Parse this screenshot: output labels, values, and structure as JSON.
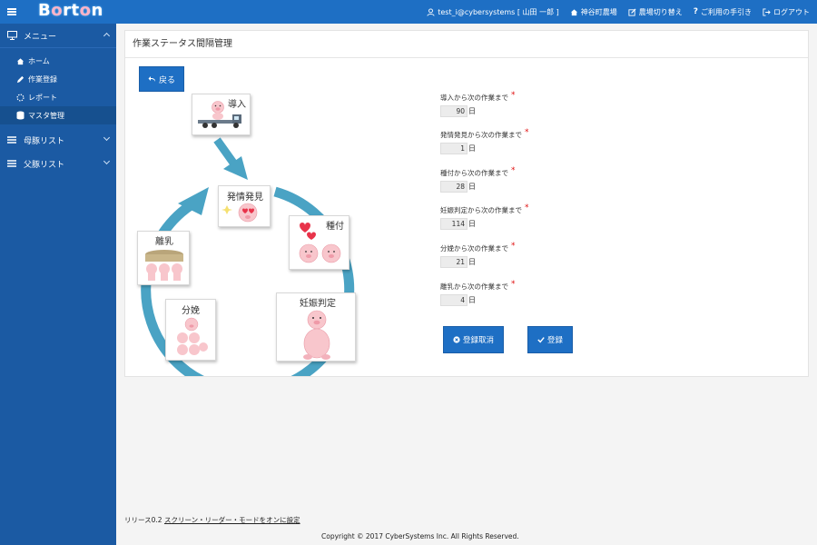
{
  "app": {
    "logo": "Borton"
  },
  "header": {
    "user": "test_i@cybersystems [ 山田 一郎 ]",
    "farm": "神谷町農場",
    "switch_farm": "農場切り替え",
    "guide": "ご利用の手引き",
    "logout": "ログアウト"
  },
  "sidebar": {
    "menu": "メニュー",
    "items": [
      "ホーム",
      "作業登録",
      "レポート",
      "マスタ管理"
    ],
    "active_index": 3,
    "mother_list": "母豚リスト",
    "father_list": "父豚リスト"
  },
  "panel": {
    "title": "作業ステータス間隔管理",
    "back": "戻る",
    "cycle": {
      "intro": "導入",
      "heat": "発情発見",
      "breeding": "種付",
      "pregnancy": "妊娠判定",
      "farrowing": "分娩",
      "weaning": "離乳"
    },
    "fields": [
      {
        "label": "導入から次の作業まで",
        "value": "90",
        "unit": "日"
      },
      {
        "label": "発情発見から次の作業まで",
        "value": "1",
        "unit": "日"
      },
      {
        "label": "種付から次の作業まで",
        "value": "28",
        "unit": "日"
      },
      {
        "label": "妊娠判定から次の作業まで",
        "value": "114",
        "unit": "日"
      },
      {
        "label": "分娩から次の作業まで",
        "value": "21",
        "unit": "日"
      },
      {
        "label": "離乳から次の作業まで",
        "value": "4",
        "unit": "日"
      }
    ],
    "cancel": "登録取消",
    "submit": "登録"
  },
  "footer": {
    "release": "リリース0.2",
    "screen_reader": "スクリーン・リーダー・モードをオンに設定",
    "copyright": "Copyright © 2017 CyberSystems Inc. All Rights Reserved."
  },
  "colors": {
    "primary": "#1e6fc4",
    "sidebar": "#1b5aa3",
    "cycle_arrow": "#4aa3c4",
    "required": "#e01010"
  }
}
